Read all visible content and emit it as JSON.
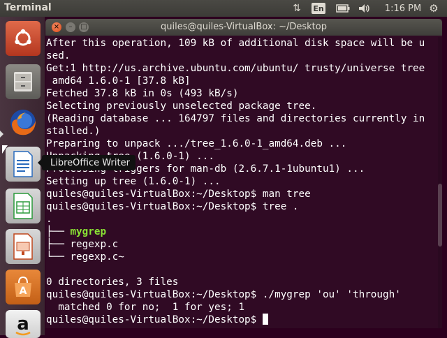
{
  "top_panel": {
    "app_title": "Terminal",
    "network_icon": "network-arrows-icon",
    "keyboard_layout": "En",
    "battery_icon": "battery-icon",
    "volume_icon": "volume-icon",
    "clock": "1:16 PM",
    "gear_icon": "gear-icon"
  },
  "launcher": {
    "items": [
      {
        "name": "Dash",
        "icon": "ubuntu-logo-icon"
      },
      {
        "name": "Files",
        "icon": "file-cabinet-icon"
      },
      {
        "name": "Firefox",
        "icon": "firefox-icon"
      },
      {
        "name": "LibreOffice Writer",
        "icon": "libreoffice-writer-icon"
      },
      {
        "name": "LibreOffice Calc",
        "icon": "libreoffice-calc-icon"
      },
      {
        "name": "LibreOffice Impress",
        "icon": "libreoffice-impress-icon"
      },
      {
        "name": "Ubuntu Software Center",
        "icon": "software-center-icon"
      },
      {
        "name": "Amazon",
        "icon": "amazon-icon"
      }
    ],
    "tooltip": "LibreOffice Writer"
  },
  "terminal": {
    "window_title": "quiles@quiles-VirtualBox: ~/Desktop",
    "close_glyph": "×",
    "min_glyph": "–",
    "max_glyph": "□",
    "lines": [
      "After this operation, 109 kB of additional disk space will be u",
      "sed.",
      "Get:1 http://us.archive.ubuntu.com/ubuntu/ trusty/universe tree",
      " amd64 1.6.0-1 [37.8 kB]",
      "Fetched 37.8 kB in 0s (493 kB/s)",
      "Selecting previously unselected package tree.",
      "(Reading database ... 164797 files and directories currently in",
      "stalled.)",
      "Preparing to unpack .../tree_1.6.0-1_amd64.deb ...",
      "Unpacking tree (1.6.0-1) ...",
      "Processing triggers for man-db (2.6.7.1-1ubuntu1) ...",
      "Setting up tree (1.6.0-1) ...",
      "quiles@quiles-VirtualBox:~/Desktop$ man tree",
      "quiles@quiles-VirtualBox:~/Desktop$ tree .",
      ".",
      "├── ",
      "├── regexp.c",
      "└── regexp.c~",
      "",
      "0 directories, 3 files",
      "quiles@quiles-VirtualBox:~/Desktop$ ./mygrep 'ou' 'through'",
      "  matched 0 for no;  1 for yes; 1",
      "quiles@quiles-VirtualBox:~/Desktop$ "
    ],
    "tree_highlight": "mygrep"
  },
  "colors": {
    "terminal_bg": "#300a24",
    "executable_green": "#8ae234",
    "close_button": "#de4b18"
  }
}
